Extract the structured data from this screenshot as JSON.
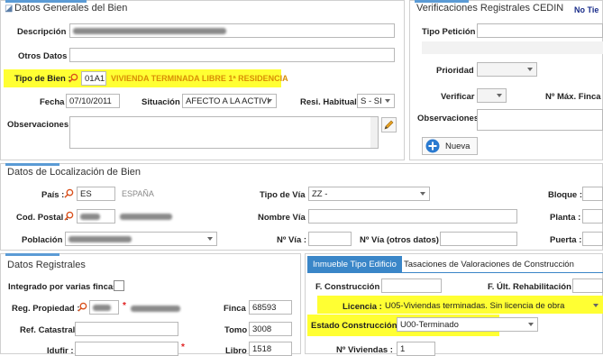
{
  "general": {
    "title": "Datos Generales del Bien",
    "descripcion_label": "Descripción :",
    "otros_datos_label": "Otros Datos :",
    "tipo_bien_label": "Tipo de Bien :",
    "tipo_bien_code": "01A1",
    "tipo_bien_desc": "VIVIENDA TERMINADA LIBRE 1ª RESIDENCIA",
    "fecha_label": "Fecha :",
    "fecha_value": "07/10/2011",
    "situacion_label": "Situación :",
    "situacion_value": "AFECTO A LA ACTIVI",
    "resi_label": "Resi. Habitual :",
    "resi_value": "S - SI",
    "observaciones_label": "Observaciones :"
  },
  "cedin": {
    "title": "Verificaciones Registrales CEDIN",
    "no_label": "No Tie",
    "tipo_peticion_label": "Tipo Petición :",
    "prioridad_label": "Prioridad :",
    "verificar_label": "Verificar :",
    "max_label": "Nº Máx. Finca",
    "observaciones_label": "Observaciones :",
    "nueva_label": "Nueva"
  },
  "localizacion": {
    "title": "Datos de Localización de Bien",
    "pais_label": "País :",
    "pais_code": "ES",
    "pais_name": "ESPAÑA",
    "tipo_via_label": "Tipo de Vía :",
    "tipo_via_value": "ZZ -",
    "bloque_label": "Bloque :",
    "cp_label": "Cod. Postal :",
    "nombre_via_label": "Nombre Vía :",
    "planta_label": "Planta :",
    "poblacion_label": "Población :",
    "num_via_label": "Nº Vía :",
    "num_otros_label": "Nº Vía (otros datos) :",
    "puerta_label": "Puerta :"
  },
  "registrales": {
    "title": "Datos Registrales",
    "integrado_label": "Integrado por varias fincas :",
    "reg_propiedad_label": "Reg. Propiedad :",
    "finca_label": "Finca :",
    "finca_value": "68593",
    "ref_catastral_label": "Ref. Catastral :",
    "tomo_label": "Tomo :",
    "tomo_value": "3008",
    "idufir_label": "Idufir :",
    "libro_label": "Libro :",
    "libro_value": "1518"
  },
  "edificio": {
    "tab_active": "Inmueble Tipo Edificio",
    "tab_other": "Tasaciones de Valoraciones de Construcción",
    "f_construccion_label": "F. Construcción :",
    "f_rehab_label": "F. Últ. Rehabilitación :",
    "licencia_label": "Licencia :",
    "licencia_value": "U05-Viviendas terminadas. Sin licencia de obra",
    "estado_label": "Estado Construcción :",
    "estado_value": "U00-Terminado",
    "num_viviendas_label": "Nº Viviendas :",
    "num_viviendas_value": "1"
  },
  "colors": {
    "highlight": "#ffff33",
    "accent": "#5b9bd5",
    "tab_active_bg": "#3a86c8",
    "orange_text": "#d98e04",
    "required": "#e02020"
  }
}
